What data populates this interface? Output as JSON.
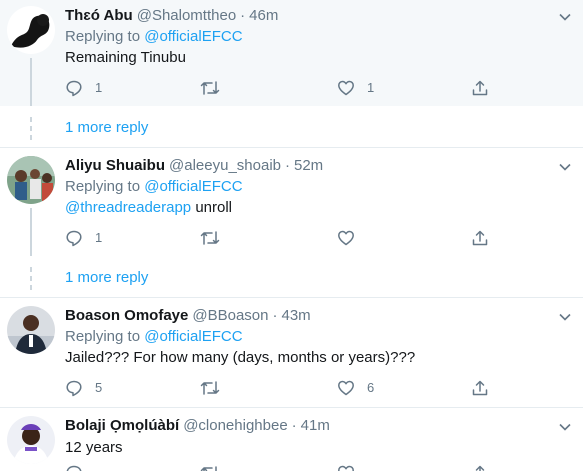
{
  "colors": {
    "accent": "#1da1f2",
    "muted": "#657786",
    "line": "#ccd6dd",
    "highlight_bg": "#f5f8fa"
  },
  "icons": {
    "reply": "reply-icon",
    "retweet": "retweet-icon",
    "like": "heart-icon",
    "share": "share-icon",
    "menu": "chevron-down-icon"
  },
  "tweets": [
    {
      "name": "Thɛó Abu",
      "handle": "@Shalomttheo",
      "time": "46m",
      "replying_prefix": "Replying to",
      "replying_to": "@officialEFCC",
      "text": "Remaining Tinubu",
      "replies": "1",
      "retweets": "",
      "likes": "1"
    },
    {
      "name": "Aliyu Shuaibu",
      "handle": "@aleeyu_shoaib",
      "time": "52m",
      "replying_prefix": "Replying to",
      "replying_to": "@officialEFCC",
      "mention": "@threadreaderapp",
      "text": "unroll",
      "replies": "1",
      "retweets": "",
      "likes": ""
    },
    {
      "name": "Boason Omofaye",
      "handle": "@BBoason",
      "time": "43m",
      "replying_prefix": "Replying to",
      "replying_to": "@officialEFCC",
      "text": "Jailed??? For how many (days, months or years)???",
      "replies": "5",
      "retweets": "",
      "likes": "6"
    },
    {
      "name": "Bolaji Ọmọlúàbí",
      "handle": "@clonehighbee",
      "time": "41m",
      "text": "12 years"
    }
  ],
  "more_replies": [
    "1 more reply",
    "1 more reply"
  ],
  "separator_dot": "·"
}
